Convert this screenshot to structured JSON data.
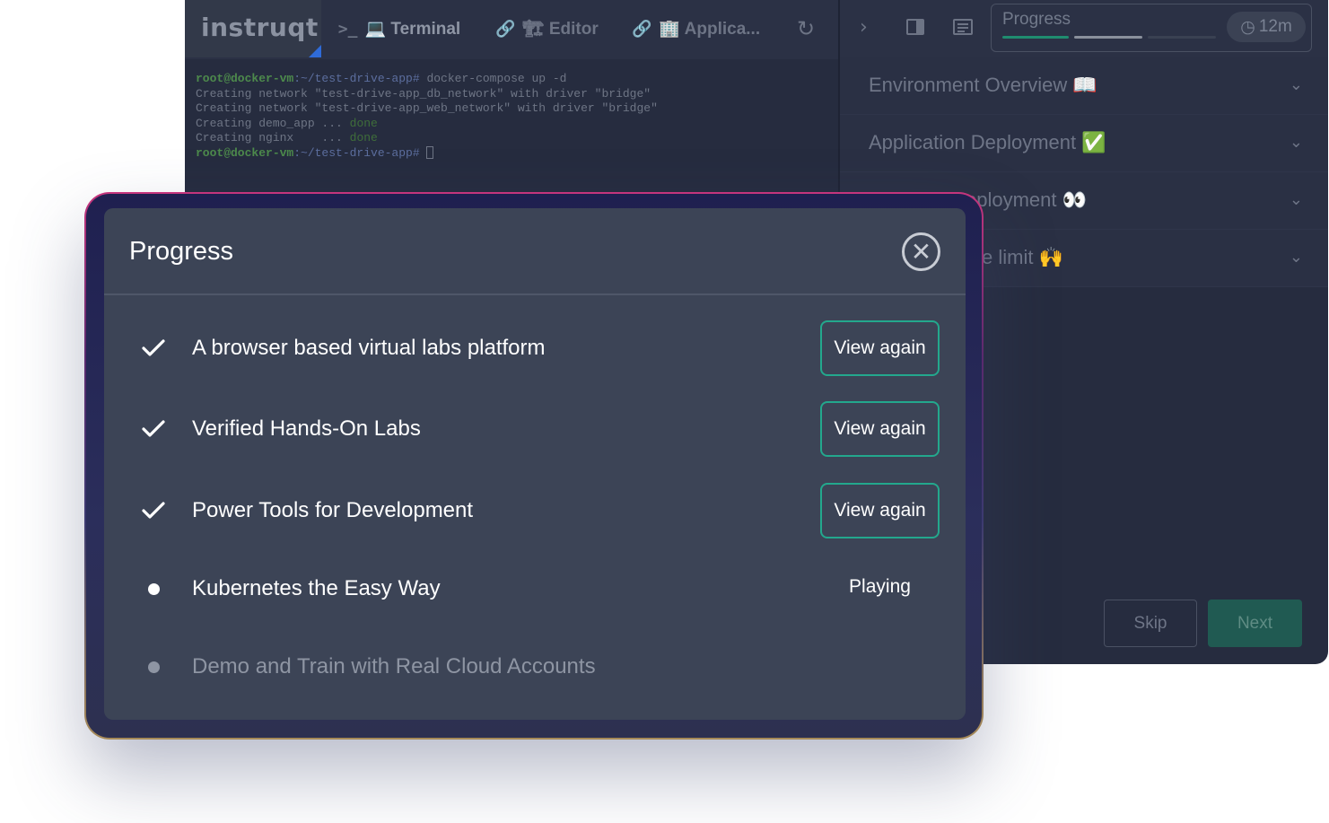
{
  "app": {
    "logo": "instruqt",
    "tabs": [
      {
        "icon": ">_",
        "label": "💻 Terminal"
      },
      {
        "icon": "🔗",
        "label": "🏗 Editor"
      },
      {
        "icon": "🔗",
        "label": "🏢 Applica..."
      }
    ],
    "header_progress_label": "Progress",
    "timer": "12m",
    "terminal_lines": [
      {
        "prompt": "root@docker-vm",
        "path": ":~/test-drive-app#",
        "text": " docker-compose up -d"
      },
      {
        "text": "Creating network \"test-drive-app_db_network\" with driver \"bridge\""
      },
      {
        "text": "Creating network \"test-drive-app_web_network\" with driver \"bridge\""
      },
      {
        "text": "Creating demo_app ... ",
        "done": "done"
      },
      {
        "text": "Creating nginx    ... ",
        "done": "done"
      },
      {
        "prompt": "root@docker-vm",
        "path": ":~/test-drive-app#",
        "text": " "
      }
    ],
    "accordion": [
      "Environment Overview 📖",
      "Application Deployment ✅",
      "eployment 👀",
      "e limit 🙌"
    ],
    "skip_label": "Skip",
    "next_label": "Next",
    "colors": {
      "progress_done": "#1f8c6f",
      "progress_active": "#8a909c",
      "progress_todo": "#3a4152"
    }
  },
  "modal": {
    "title": "Progress",
    "close_icon": "close-circle-icon",
    "items": [
      {
        "label": "A browser based virtual labs platform",
        "status": "completed",
        "action": "View again"
      },
      {
        "label": "Verified Hands-On Labs",
        "status": "completed",
        "action": "View again"
      },
      {
        "label": "Power Tools for Development",
        "status": "completed",
        "action": "View again"
      },
      {
        "label": "Kubernetes the Easy Way",
        "status": "playing",
        "action": "Playing"
      },
      {
        "label": "Demo and Train with Real Cloud Accounts",
        "status": "locked",
        "action": ""
      }
    ],
    "colors": {
      "accent": "#23a88d",
      "background": "#3c4456"
    }
  }
}
